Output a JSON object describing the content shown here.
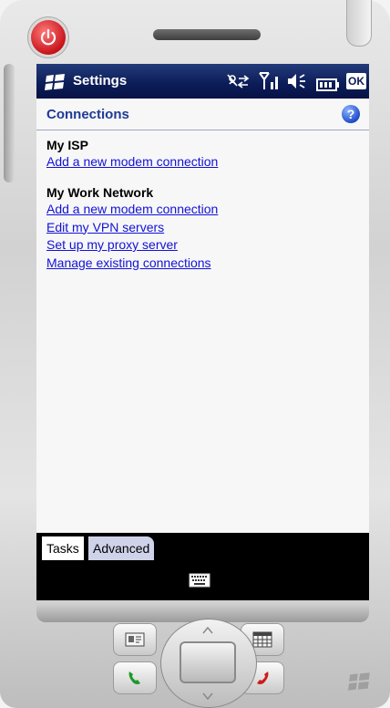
{
  "titlebar": {
    "title": "Settings",
    "ok_label": "OK"
  },
  "header": {
    "title": "Connections",
    "help_label": "?"
  },
  "sections": [
    {
      "title": "My ISP",
      "links": [
        "Add a new modem connection"
      ]
    },
    {
      "title": "My Work Network",
      "links": [
        "Add a new modem connection",
        "Edit my VPN servers",
        "Set up my proxy server",
        "Manage existing connections"
      ]
    }
  ],
  "tabs": [
    "Tasks",
    "Advanced"
  ],
  "icons": {
    "start": "windows-flag-icon",
    "sync": "connectivity-icon",
    "signal": "signal-icon",
    "volume": "speaker-icon",
    "battery": "battery-icon",
    "keyboard": "keyboard-icon",
    "power": "power-icon",
    "call": "call-icon",
    "end": "end-call-icon"
  },
  "colors": {
    "titlebar": "#0b1c57",
    "header_text": "#1f3a93",
    "link": "#1212d8",
    "power": "#c8141a"
  }
}
